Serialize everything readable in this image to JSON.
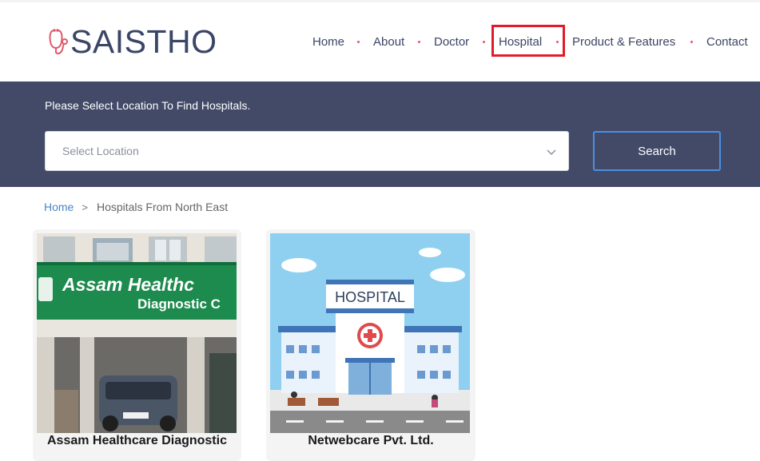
{
  "logo": {
    "text": "SAISTHO",
    "icon": "stethoscope-icon"
  },
  "nav": {
    "items": [
      {
        "label": "Home"
      },
      {
        "label": "About"
      },
      {
        "label": "Doctor"
      },
      {
        "label": "Hospital",
        "highlighted": true
      },
      {
        "label": "Product & Features"
      },
      {
        "label": "Contact"
      }
    ]
  },
  "search": {
    "caption": "Please Select Location To Find Hospitals.",
    "placeholder": "Select Location",
    "button_label": "Search"
  },
  "breadcrumb": {
    "home": "Home",
    "separator": ">",
    "current": "Hospitals From North East"
  },
  "hospitals": [
    {
      "name": "Assam Healthcare Diagnostic",
      "photo_sign_line1": "Assam Healthc",
      "photo_sign_line2": "Diagnostic C"
    },
    {
      "name": "Netwebcare Pvt. Ltd.",
      "illustration_label": "HOSPITAL"
    }
  ],
  "colors": {
    "brand": "#3b4565",
    "band": "#424a68",
    "highlight": "#e21b2a",
    "link": "#4a86c5",
    "accent_button_border": "#4a90e2"
  }
}
